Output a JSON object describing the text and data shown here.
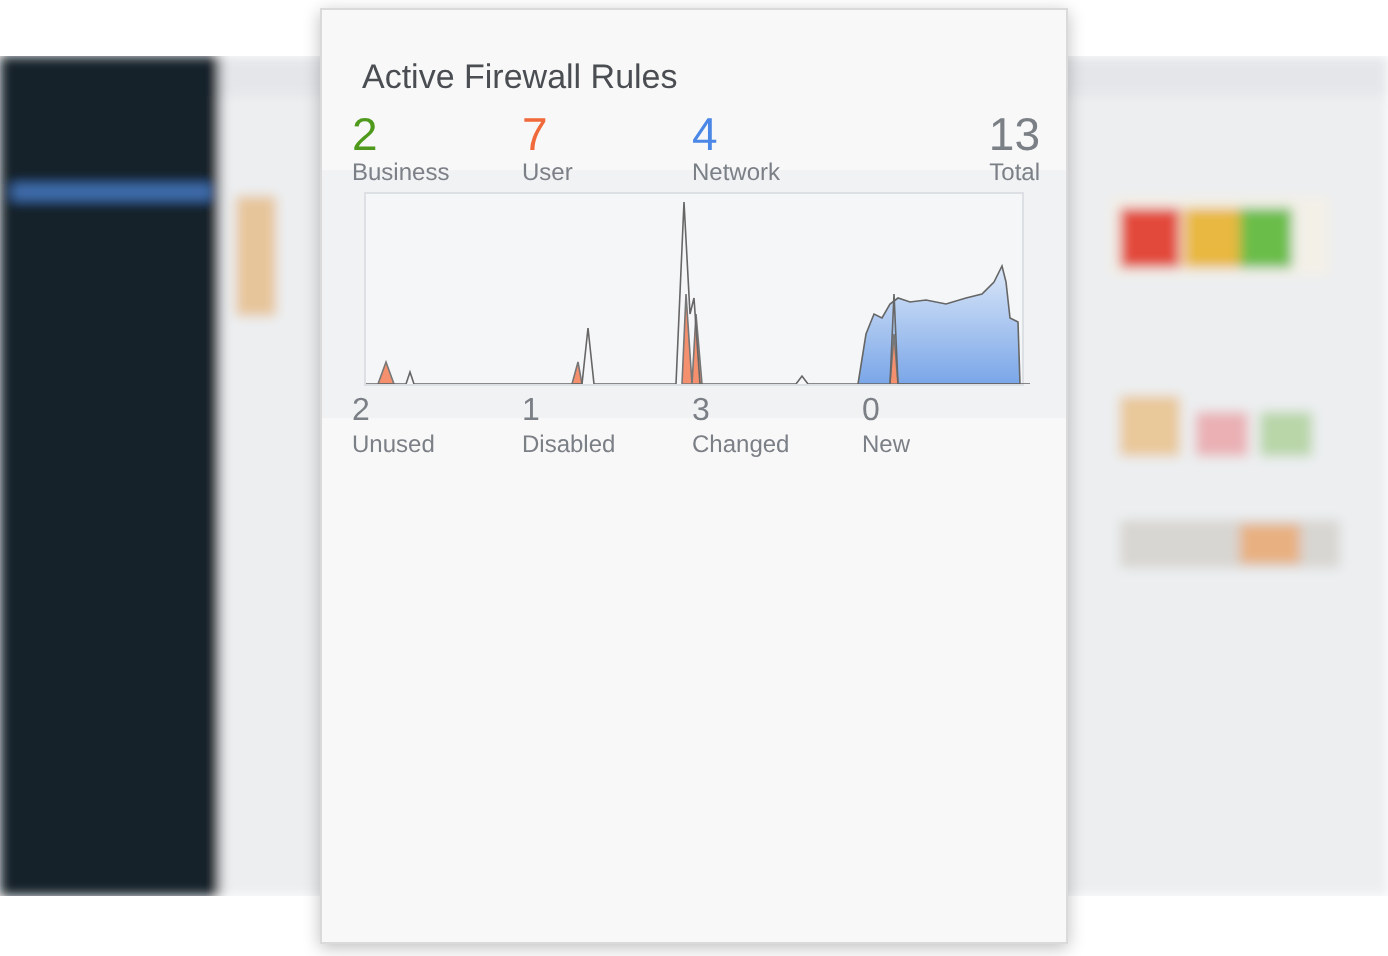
{
  "card": {
    "title": "Active Firewall Rules",
    "stats": [
      {
        "value": "2",
        "label": "Business",
        "color": "#4f9a1c"
      },
      {
        "value": "7",
        "label": "User",
        "color": "#f0693a"
      },
      {
        "value": "4",
        "label": "Network",
        "color": "#4a87e6"
      },
      {
        "value": "13",
        "label": "Total",
        "color": "#7b7f86"
      }
    ],
    "summary": [
      {
        "value": "2",
        "label": "Unused"
      },
      {
        "value": "1",
        "label": "Disabled"
      },
      {
        "value": "3",
        "label": "Changed"
      },
      {
        "value": "0",
        "label": "New"
      }
    ]
  }
}
